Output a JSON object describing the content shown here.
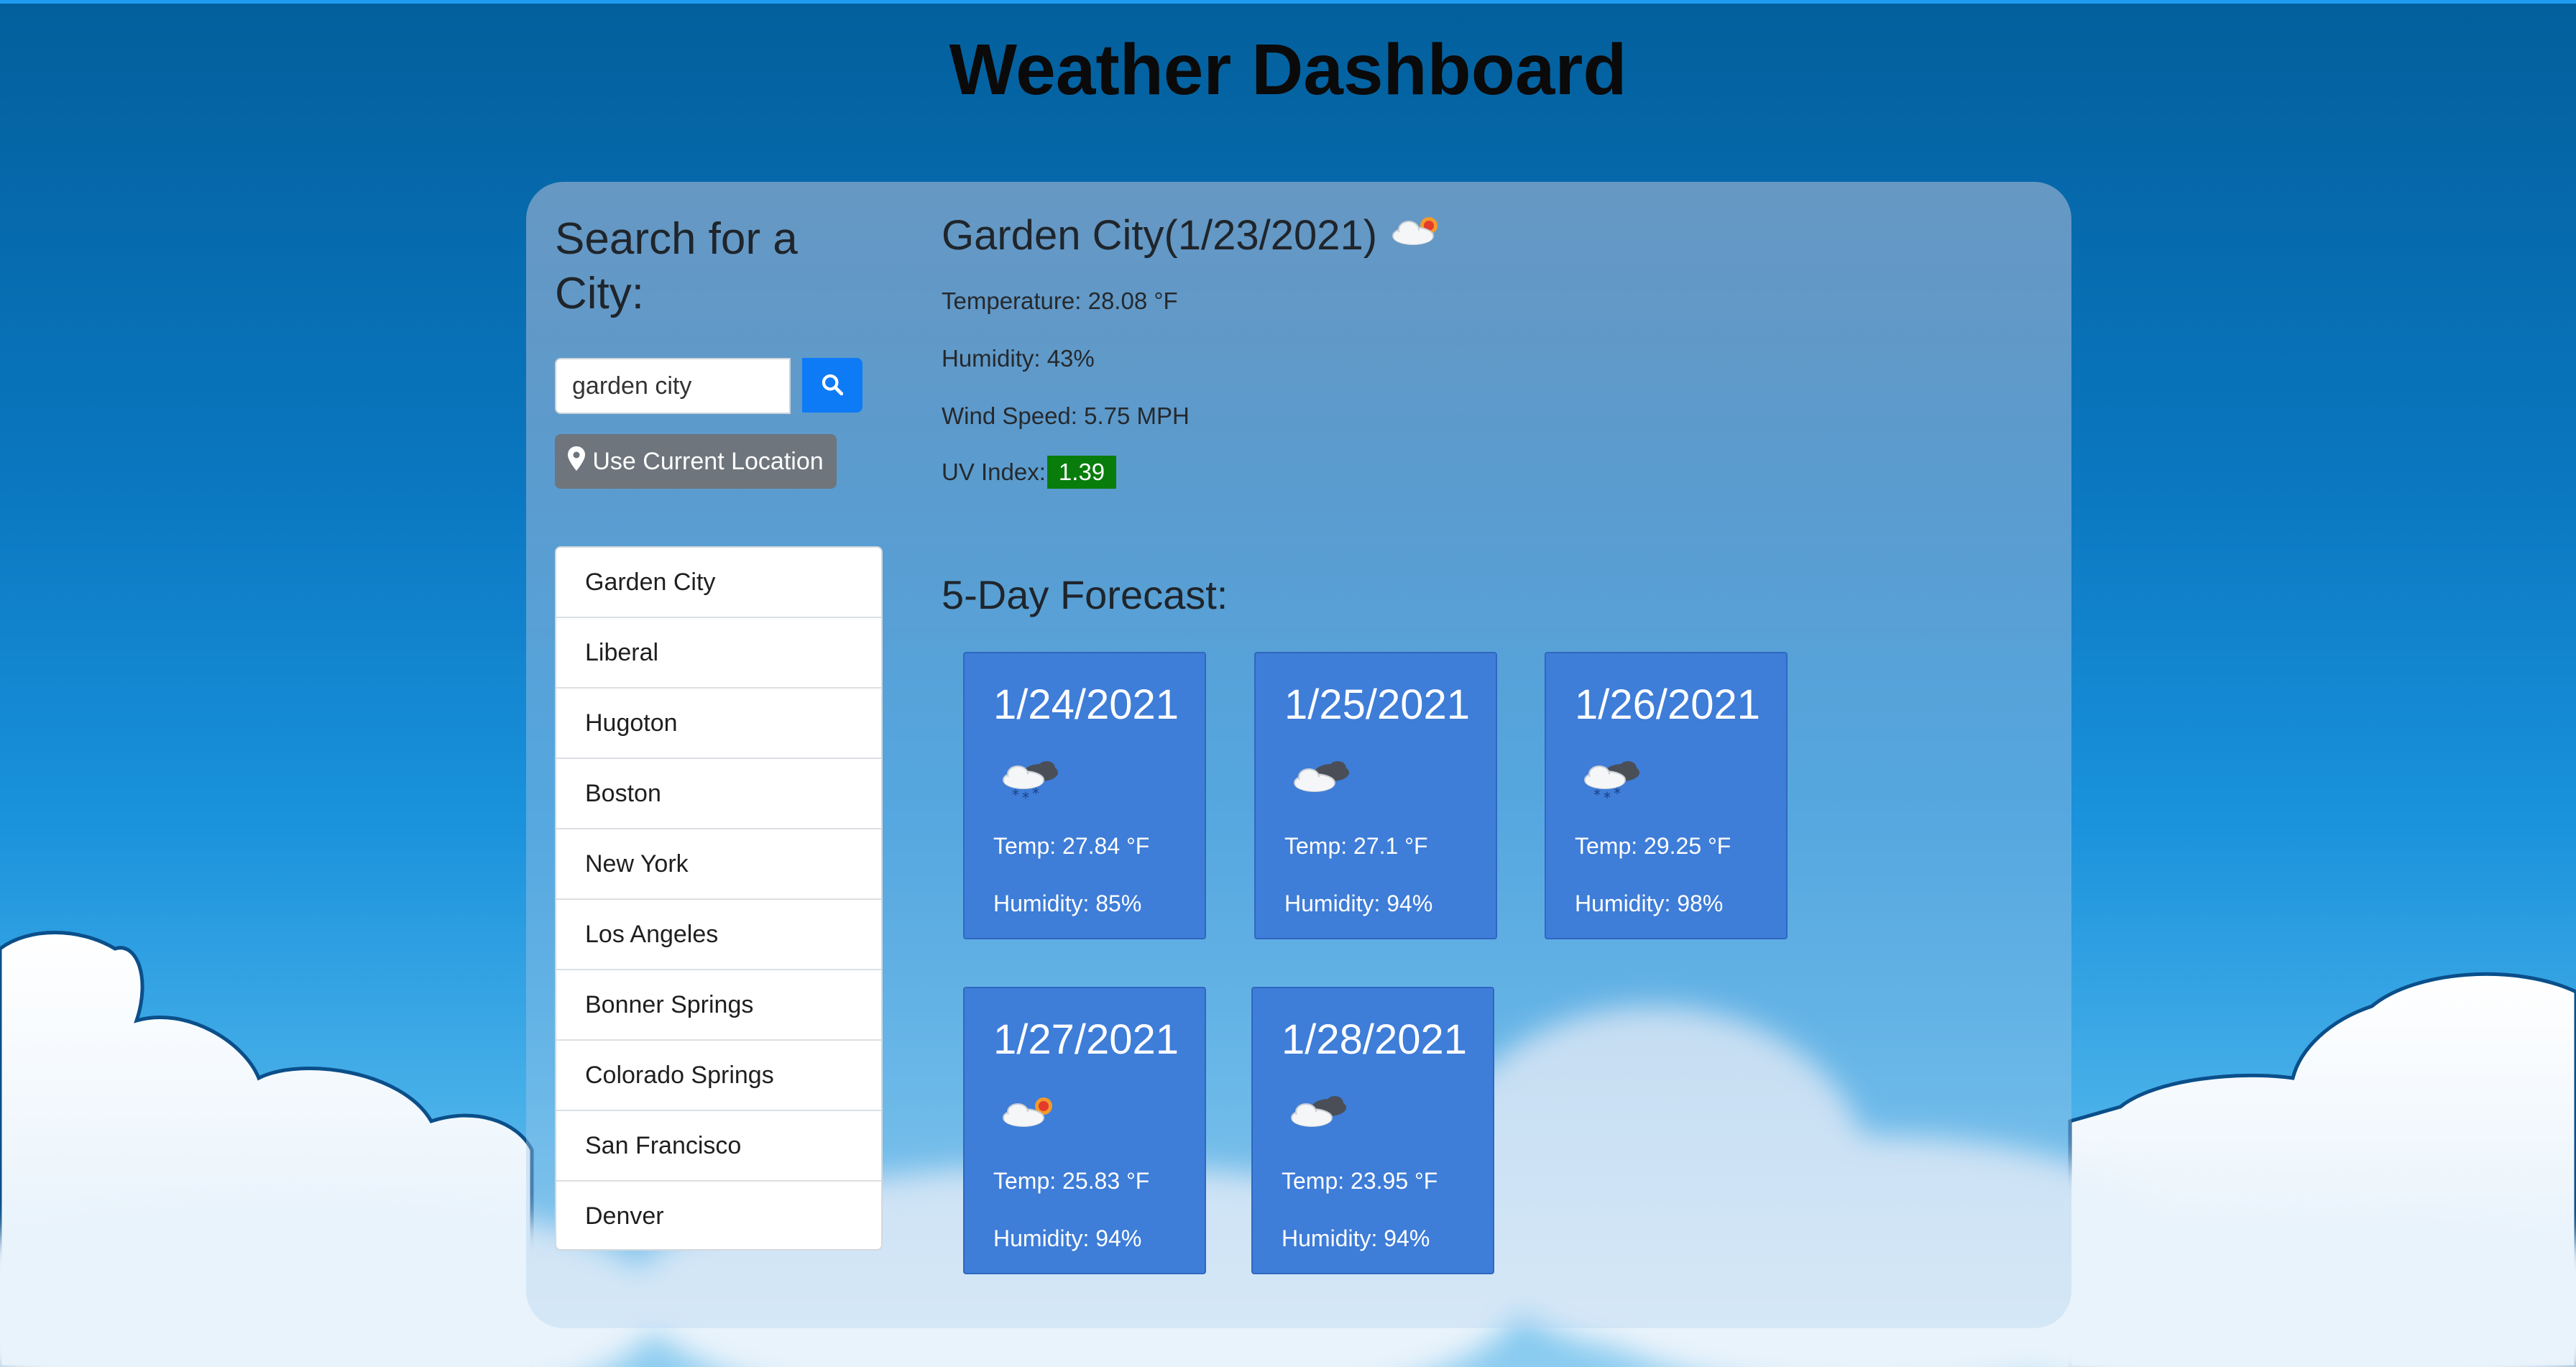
{
  "page": {
    "title": "Weather Dashboard"
  },
  "search": {
    "heading": "Search for a City:",
    "input_value": "garden city",
    "search_icon": "search-icon",
    "location_button_label": "Use Current Location",
    "location_icon": "map-marker-icon"
  },
  "history": [
    "Garden City",
    "Liberal",
    "Hugoton",
    "Boston",
    "New York",
    "Los Angeles",
    "Bonner Springs",
    "Colorado Springs",
    "San Francisco",
    "Denver"
  ],
  "current": {
    "title": "Garden City(1/23/2021)",
    "icon": "few-clouds-day-icon",
    "temperature": "Temperature: 28.08 °F",
    "humidity": "Humidity: 43%",
    "wind": "Wind Speed: 5.75 MPH",
    "uv_label": "UV Index:",
    "uv_value": "1.39",
    "uv_color": "#087d0b"
  },
  "forecast": {
    "heading": "5-Day Forecast:",
    "days": [
      {
        "date": "1/24/2021",
        "icon": "snow-icon",
        "temp": "Temp: 27.84 °F",
        "humidity": "Humidity: 85%"
      },
      {
        "date": "1/25/2021",
        "icon": "broken-clouds-icon",
        "temp": "Temp: 27.1 °F",
        "humidity": "Humidity: 94%"
      },
      {
        "date": "1/26/2021",
        "icon": "snow-icon",
        "temp": "Temp: 29.25 °F",
        "humidity": "Humidity: 98%"
      },
      {
        "date": "1/27/2021",
        "icon": "few-clouds-day-icon",
        "temp": "Temp: 25.83 °F",
        "humidity": "Humidity: 94%"
      },
      {
        "date": "1/28/2021",
        "icon": "broken-clouds-icon",
        "temp": "Temp: 23.95 °F",
        "humidity": "Humidity: 94%"
      }
    ],
    "card_color": "#3e7dd8"
  }
}
